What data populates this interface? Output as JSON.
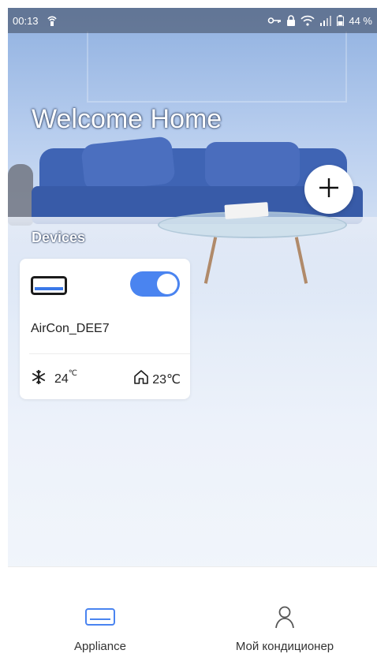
{
  "status_bar": {
    "time": "00:13",
    "battery": "44 %",
    "icons": [
      "hotspot-icon",
      "key-icon",
      "lock-icon",
      "wifi-icon",
      "signal-icon",
      "battery-icon"
    ]
  },
  "header": {
    "title": "Welcome Home",
    "add_button_icon": "plus-icon"
  },
  "devices": {
    "section_title": "Devices",
    "items": [
      {
        "name": "AirCon_DEE7",
        "power_on": true,
        "set_temperature": "24",
        "set_temperature_unit": "℃",
        "room_temperature": "23℃",
        "mode_icon": "snowflake-icon",
        "room_icon": "home-icon"
      }
    ]
  },
  "bottom_nav": {
    "items": [
      {
        "label": "Appliance",
        "icon": "air-conditioner-icon",
        "active": true
      },
      {
        "label": "Мой кондиционер",
        "icon": "person-icon",
        "active": false
      }
    ]
  },
  "colors": {
    "accent": "#4a84f0",
    "nav_active": "#4a84f0",
    "nav_inactive": "#555555"
  }
}
